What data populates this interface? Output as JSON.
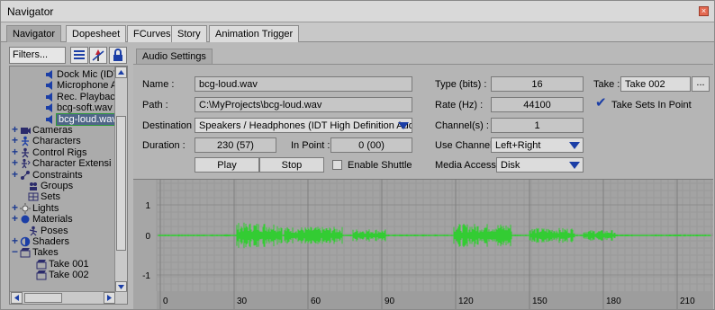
{
  "window": {
    "title": "Navigator",
    "close_glyph": "×"
  },
  "tabs": [
    "Navigator",
    "Dopesheet",
    "FCurves",
    "Story",
    "Animation Trigger"
  ],
  "left": {
    "filters_label": "Filters...",
    "tree": [
      {
        "label": "Dock Mic (IDT H",
        "indent": 3,
        "icon": "speaker-icon",
        "expander": ""
      },
      {
        "label": "Microphone Arr",
        "indent": 3,
        "icon": "speaker-icon",
        "expander": ""
      },
      {
        "label": "Rec. Playback (",
        "indent": 3,
        "icon": "speaker-icon",
        "expander": ""
      },
      {
        "label": "bcg-soft.wav",
        "indent": 3,
        "icon": "speaker-icon",
        "expander": ""
      },
      {
        "label": "bcg-loud.wav",
        "indent": 3,
        "icon": "speaker-icon",
        "expander": "",
        "selected": true
      },
      {
        "label": "Cameras",
        "indent": 0,
        "icon": "camera-icon",
        "expander": "+"
      },
      {
        "label": "Characters",
        "indent": 0,
        "icon": "character-icon",
        "expander": "+"
      },
      {
        "label": "Control Rigs",
        "indent": 0,
        "icon": "control-rig-icon",
        "expander": "+"
      },
      {
        "label": "Character Extensi",
        "indent": 0,
        "icon": "character-extension-icon",
        "expander": "+"
      },
      {
        "label": "Constraints",
        "indent": 0,
        "icon": "constraint-icon",
        "expander": "+"
      },
      {
        "label": "Groups",
        "indent": 1,
        "icon": "groups-icon",
        "expander": ""
      },
      {
        "label": "Sets",
        "indent": 1,
        "icon": "sets-icon",
        "expander": ""
      },
      {
        "label": "Lights",
        "indent": 0,
        "icon": "light-icon",
        "expander": "+"
      },
      {
        "label": "Materials",
        "indent": 0,
        "icon": "material-icon",
        "expander": "+"
      },
      {
        "label": "Poses",
        "indent": 1,
        "icon": "pose-icon",
        "expander": ""
      },
      {
        "label": "Shaders",
        "indent": 0,
        "icon": "shader-icon",
        "expander": "+"
      },
      {
        "label": "Takes",
        "indent": 0,
        "icon": "take-icon",
        "expander": "−"
      },
      {
        "label": "Take 001",
        "indent": 2,
        "icon": "take-icon",
        "expander": ""
      },
      {
        "label": "Take 002",
        "indent": 2,
        "icon": "take-icon",
        "expander": ""
      }
    ]
  },
  "audio": {
    "tab_label": "Audio Settings",
    "name_label": "Name :",
    "name_value": "bcg-loud.wav",
    "path_label": "Path :",
    "path_value": "C:\\MyProjects\\bcg-loud.wav",
    "destination_label": "Destination :",
    "destination_value": "Speakers / Headphones (IDT High Definition Audio C...",
    "duration_label": "Duration :",
    "duration_value": "230 (57)",
    "inpoint_label": "In Point :",
    "inpoint_value": "0 (00)",
    "play_label": "Play",
    "stop_label": "Stop",
    "shuttle_label": "Enable Shuttle",
    "type_label": "Type (bits) :",
    "type_value": "16",
    "rate_label": "Rate (Hz) :",
    "rate_value": "44100",
    "channels_label": "Channel(s) :",
    "channels_value": "1",
    "use_channel_label": "Use Channel :",
    "use_channel_value": "Left+Right",
    "media_label": "Media Access :",
    "media_value": "Disk",
    "take_label": "Take :",
    "take_value": "Take 002",
    "take_browse": "...",
    "take_sets_label": "Take Sets In Point",
    "take_sets_checked": true
  },
  "waveform": {
    "y_ticks": [
      "1",
      "0",
      "-1"
    ],
    "x_ticks": [
      "0",
      "30",
      "60",
      "90",
      "120",
      "150",
      "180",
      "210"
    ],
    "wave_color": "#33cc33"
  }
}
